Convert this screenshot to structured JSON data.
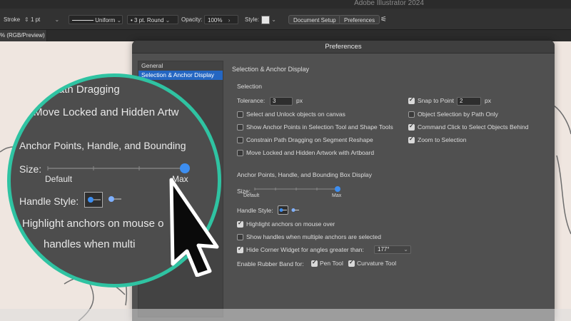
{
  "app": {
    "title": "Adobe Illustrator 2024"
  },
  "control_bar": {
    "stroke_label": "Stroke",
    "stroke_weight": "1 pt",
    "profile": "Uniform",
    "brush": "3 pt. Round",
    "opacity_label": "Opacity:",
    "opacity_value": "100%",
    "style_label": "Style:",
    "document_setup": "Document Setup",
    "preferences": "Preferences"
  },
  "document_tab": {
    "label": "% (RGB/Preview)"
  },
  "dialog": {
    "title": "Preferences",
    "nav": [
      {
        "label": "General"
      },
      {
        "label": "Selection & Anchor Display"
      }
    ],
    "heading": "Selection & Anchor Display",
    "selection": {
      "title": "Selection",
      "tolerance_label": "Tolerance:",
      "tolerance_value": "3",
      "tolerance_unit": "px",
      "left_options": [
        {
          "label": "Select and Unlock objects on canvas",
          "checked": false
        },
        {
          "label": "Show Anchor Points in Selection Tool and Shape Tools",
          "checked": false
        },
        {
          "label": "Constrain Path Dragging on Segment Reshape",
          "checked": false
        },
        {
          "label": "Move Locked and Hidden Artwork with Artboard",
          "checked": false
        }
      ],
      "snap_label": "Snap to Point",
      "snap_value": "2",
      "snap_unit": "px",
      "snap_checked": true,
      "right_options": [
        {
          "label": "Object Selection by Path Only",
          "checked": false
        },
        {
          "label": "Command Click to Select Objects Behind",
          "checked": true
        },
        {
          "label": "Zoom to Selection",
          "checked": true
        }
      ]
    },
    "anchor": {
      "title": "Anchor Points, Handle, and Bounding Box Display",
      "size_label": "Size:",
      "size_min_label": "Default",
      "size_max_label": "Max",
      "size_level": 1.0,
      "handle_style_label": "Handle Style:",
      "options": [
        {
          "label": "Highlight anchors on mouse over",
          "checked": true
        },
        {
          "label": "Show handles when multiple anchors are selected",
          "checked": false
        },
        {
          "label": "Hide Corner Widget for angles greater than:",
          "checked": true
        }
      ],
      "corner_angle": "177°",
      "rubber_band_label": "Enable Rubber Band for:",
      "rubber_band": [
        {
          "label": "Pen Tool",
          "checked": true
        },
        {
          "label": "Curvature Tool",
          "checked": true
        }
      ]
    }
  },
  "magnifier": {
    "line1": "strain Path Dragging",
    "line2": "Move Locked and Hidden Artw",
    "heading": "Anchor Points, Handle, and Bounding",
    "size_label": "Size:",
    "default_label": "Default",
    "max_label": "Max",
    "handle_style_label": "Handle Style:",
    "line3": "Highlight anchors on mouse o",
    "line4": "handles when multi"
  },
  "colors": {
    "accent": "#2466c2",
    "magnifier_ring": "#2fc3a2",
    "slider_knob": "#3d8ef0"
  }
}
